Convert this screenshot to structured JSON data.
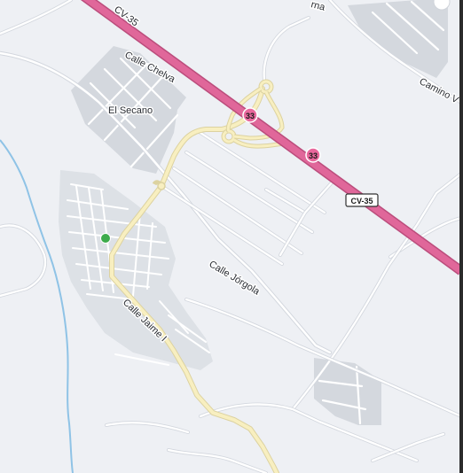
{
  "map": {
    "colors": {
      "background": "#eef0f4",
      "urban_area": "#dde1e6",
      "industrial_block": "#d4d8de",
      "minor_road": "#ffffff",
      "minor_road_casing": "#d3d7de",
      "local_main_road": "#f8efc0",
      "local_main_road_casing": "#dcd2a0",
      "motorway": "#e0679a",
      "motorway_casing": "#bb4d7c",
      "water": "#8fc3e6",
      "marker": "#3cab4b"
    },
    "labels": {
      "el_secano": "El Secano",
      "calle_chelva": "Calle Chelva",
      "calle_jorgola": "Calle Jórgola",
      "calle_jaime_i": "Calle Jaime I",
      "camino": "Camino V",
      "top_road_label": "CV-35",
      "top_partial_label": "rna"
    },
    "shields": {
      "exit_33_upper": "33",
      "exit_33_lower": "33",
      "cv35": "CV-35"
    },
    "marker": {
      "icon": "green-location-dot"
    }
  }
}
